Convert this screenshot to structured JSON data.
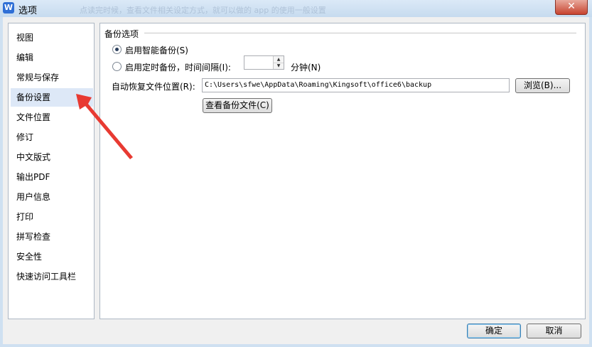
{
  "window": {
    "title": "选项",
    "app_icon_letter": "W",
    "background_text": "点读完时候，查看文件相关设定方式，就可以做的 app 的使用一般设置"
  },
  "sidebar": {
    "items": [
      {
        "label": "视图"
      },
      {
        "label": "编辑"
      },
      {
        "label": "常规与保存"
      },
      {
        "label": "备份设置",
        "selected": true
      },
      {
        "label": "文件位置"
      },
      {
        "label": "修订"
      },
      {
        "label": "中文版式"
      },
      {
        "label": "输出PDF"
      },
      {
        "label": "用户信息"
      },
      {
        "label": "打印"
      },
      {
        "label": "拼写检查"
      },
      {
        "label": "安全性"
      },
      {
        "label": "快速访问工具栏"
      }
    ]
  },
  "backup": {
    "group_title": "备份选项",
    "smart_backup_label": "启用智能备份(S)",
    "smart_backup_checked": true,
    "timed_backup_label": "启用定时备份，时间间隔(I):",
    "timed_backup_checked": false,
    "interval_value": "",
    "minutes_label": "分钟(N)",
    "auto_recover_label": "自动恢复文件位置(R):",
    "auto_recover_path": "C:\\Users\\sfwe\\AppData\\Roaming\\Kingsoft\\office6\\backup",
    "browse_label": "浏览(B)...",
    "view_backup_label": "查看备份文件(C)"
  },
  "footer": {
    "ok_label": "确定",
    "cancel_label": "取消"
  },
  "colors": {
    "annotation_arrow": "#e83a32",
    "selection": "#dde8f7",
    "title_bar": "#c6dbef"
  },
  "icons": {
    "close": "close-icon",
    "app": "wps-writer-icon",
    "spin_up": "spin-up-icon",
    "spin_down": "spin-down-icon"
  }
}
